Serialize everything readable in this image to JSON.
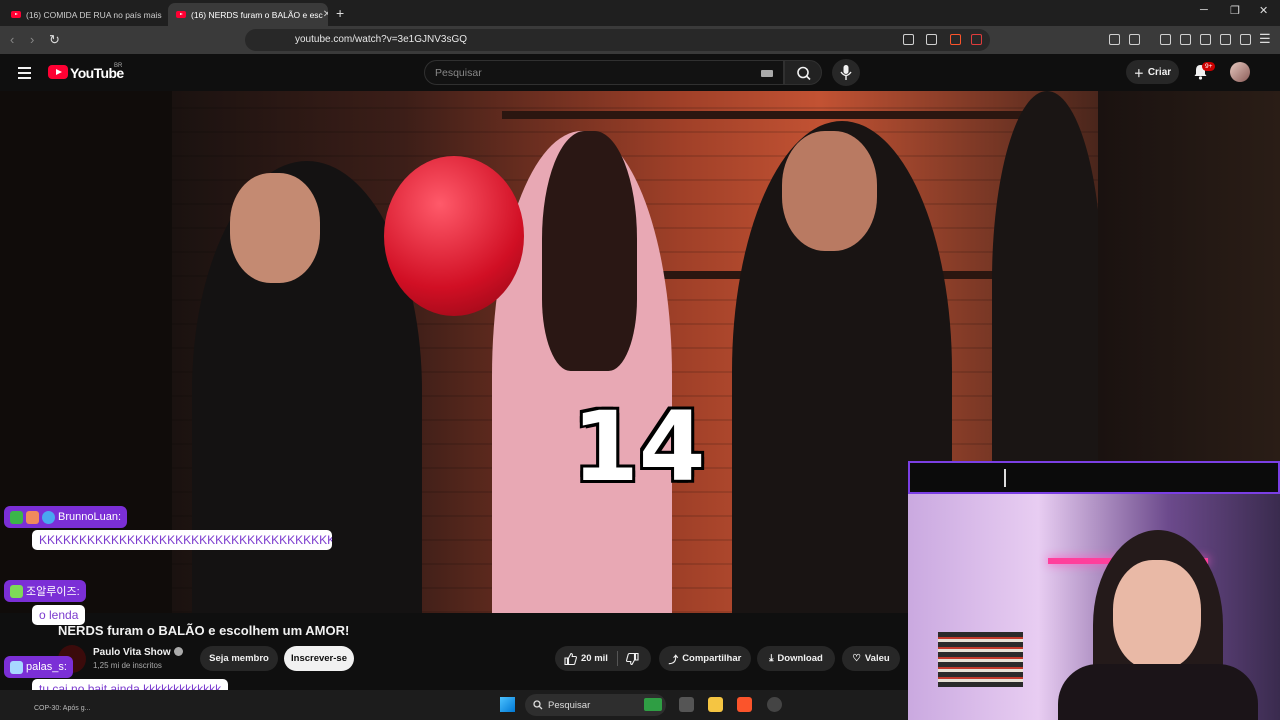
{
  "browser": {
    "tabs": [
      {
        "label": "(16) COMIDA DE RUA no país mais r"
      },
      {
        "label": "(16) NERDS furam o BALÃO e esc"
      }
    ],
    "url": "youtube.com/watch?v=3e1GJNV3sGQ"
  },
  "youtube": {
    "wordmark": "YouTube",
    "country": "BR",
    "search_placeholder": "Pesquisar",
    "create_label": "Criar",
    "notification_count": "9+"
  },
  "video": {
    "overlay_number": "14",
    "title": "NERDS furam o BALÃO e escolhem um AMOR!",
    "channel_name": "Paulo Vita Show",
    "subscribers": "1,25 mi de inscritos",
    "member_label": "Seja membro",
    "subscribe_label": "Inscrever-se",
    "likes": "20 mil",
    "share_label": "Compartilhar",
    "download_label": "Download",
    "thanks_label": "Valeu"
  },
  "chat": [
    {
      "user": "BrunnoLuan:",
      "message": "KKKKKKKKKKKKKKKKKKKKKKKKKKKKKKKKKKKKKK"
    },
    {
      "user": "조알루이즈:",
      "message": "o lenda"
    },
    {
      "user": "palas_s:",
      "message": "tu cai no bait ainda kkkkkkkkkkkkk"
    }
  ],
  "taskbar": {
    "weather": "COP-30: Após g...",
    "search_label": "Pesquisar"
  },
  "colors": {
    "chat_user_bg": "#7b2fd6",
    "chat_text": "#7c3ccf",
    "yt_red": "#ff0033",
    "cam_border": "#7b3fe4"
  }
}
